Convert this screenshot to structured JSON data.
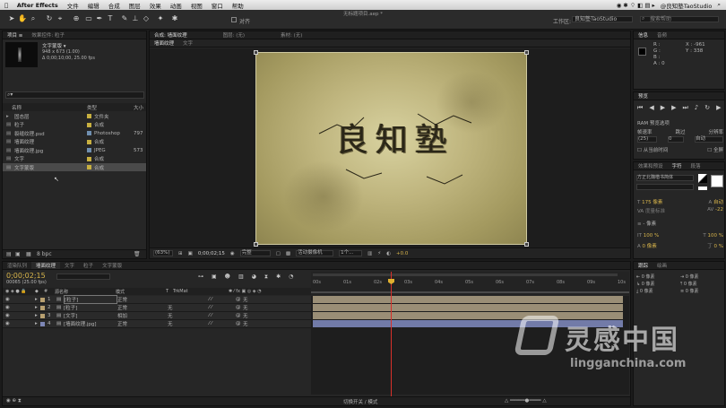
{
  "menubar": {
    "app": "After Effects",
    "items": [
      "文件",
      "编辑",
      "合成",
      "图层",
      "效果",
      "动画",
      "视图",
      "窗口",
      "帮助"
    ],
    "right": [
      "@良知塾TaoStudio"
    ]
  },
  "window_title": "无标题项目.aep *",
  "toolbar": {
    "align_label": "对齐",
    "workspace_label": "工作区:",
    "workspace_value": "良知塾TaoStudio",
    "search_placeholder": "搜索帮助"
  },
  "project": {
    "tabs": [
      "项目 ≡",
      "效果控件: 粒子"
    ],
    "selected_name": "文字蒙版 ▾",
    "selected_info": [
      "948 x 673 (1.00)",
      "Δ 0;00;10;00, 25.00 fps"
    ],
    "columns": {
      "name": "名称",
      "type": "类型",
      "size": "大小"
    },
    "items": [
      {
        "name": "固态层",
        "type": "文件夹",
        "size": "",
        "color": "#c8b040"
      },
      {
        "name": "粒子",
        "type": "合成",
        "size": "",
        "color": "#c8b040"
      },
      {
        "name": "裂缝纹理.psd",
        "type": "Photoshop",
        "size": "797",
        "color": "#6f8fb0"
      },
      {
        "name": "墙面纹理",
        "type": "合成",
        "size": "",
        "color": "#c8b040"
      },
      {
        "name": "墙面纹理.jpg",
        "type": "JPEG",
        "size": "573",
        "color": "#6f8fb0"
      },
      {
        "name": "文字",
        "type": "合成",
        "size": "",
        "color": "#c8b040"
      },
      {
        "name": "文字蒙版",
        "type": "合成",
        "size": "",
        "color": "#c8b040"
      }
    ],
    "bpc": "8 bpc"
  },
  "composition": {
    "tabs": [
      "合成: 墙面纹理",
      "图层: (无)",
      "素材: (无)"
    ],
    "sub_tabs": [
      "墙面纹理",
      "文字"
    ],
    "zoom": "(63%)",
    "timecode": "0;00;02;15",
    "quality": "完整",
    "camera": "活动摄像机",
    "views": "1个...",
    "exposure": "+0.0",
    "artwork_text": "良知塾"
  },
  "info_panel": {
    "tabs": [
      "信息",
      "音频"
    ],
    "rgb": [
      "R :",
      "G :",
      "B :",
      "A : 0"
    ],
    "coords": [
      "X : -961",
      "Y : 338"
    ]
  },
  "preview_panel": {
    "tab": "预览",
    "ram_options": "RAM 预览选项",
    "labels": [
      "帧速率",
      "跳过",
      "分辨率"
    ],
    "values": [
      "(25)",
      "0",
      "自动"
    ],
    "from_current": "从当前时间",
    "fullscreen": "全屏"
  },
  "character_panel": {
    "tabs": [
      "效果和预设",
      "字符",
      "段落"
    ],
    "font": "方正北魏楷书简体",
    "size": "175 像素",
    "leading": "自动",
    "tracking": "度量标准",
    "kerning": "-22",
    "stroke": "- 像素",
    "vscale": "100 %",
    "hscale": "100 %",
    "baseline": "0 像素",
    "tsume": "0 %"
  },
  "align_panel": {
    "tabs": [
      "跟踪",
      "绘画"
    ],
    "values": [
      "0 像素",
      "0 像素",
      "0 像素",
      "0 像素",
      "0 像素",
      "0 像素"
    ]
  },
  "timeline": {
    "tabs": [
      "渲染队列",
      "墙面纹理",
      "文字",
      "粒子",
      "文字蒙版"
    ],
    "timecode": "0;00;02;15",
    "frame_info": "00065 (25.00 fps)",
    "columns": {
      "num": "#",
      "name": "源名称",
      "mode": "模式",
      "trkmat": "TrkMat",
      "parent": "父级"
    },
    "ruler": [
      "00s",
      "01s",
      "02s",
      "03s",
      "04s",
      "05s",
      "06s",
      "07s",
      "08s",
      "09s",
      "10s"
    ],
    "layers": [
      {
        "num": "1",
        "name": "[粒子]",
        "mode": "正常",
        "trkmat": "",
        "parent": "无",
        "color": "#b8a070",
        "bar": "#9a8e76"
      },
      {
        "num": "2",
        "name": "[粒子]",
        "mode": "正常",
        "trkmat": "无",
        "parent": "无",
        "color": "#b8a070",
        "bar": "#9a8e76"
      },
      {
        "num": "3",
        "name": "[文字]",
        "mode": "相加",
        "trkmat": "无",
        "parent": "无",
        "color": "#b8a070",
        "bar": "#9a8e76"
      },
      {
        "num": "4",
        "name": "[墙面纹理.jpg]",
        "mode": "正常",
        "trkmat": "无",
        "parent": "无",
        "color": "#7d86b5",
        "bar": "#727ba8"
      }
    ],
    "footer": "切换开关 / 模式"
  },
  "watermark": {
    "brand_cn": "灵感中国",
    "brand_url": "lingganchina.com"
  }
}
